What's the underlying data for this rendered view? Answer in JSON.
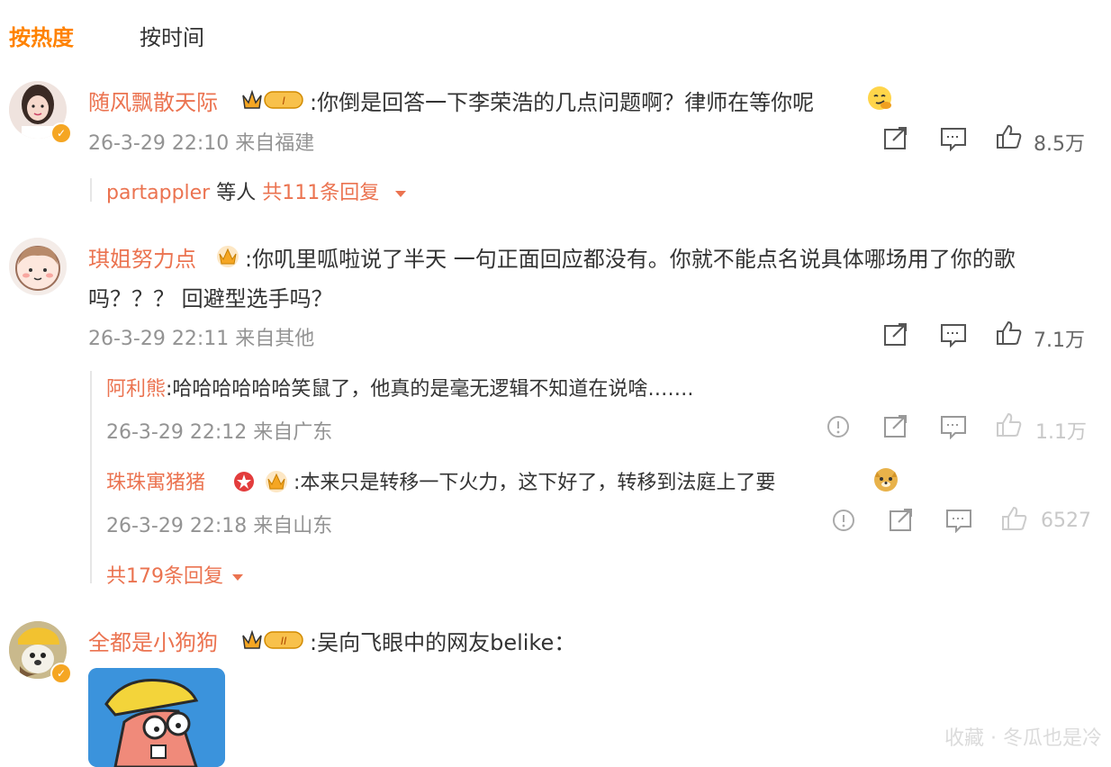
{
  "tabs": {
    "hot": "按热度",
    "time": "按时间"
  },
  "comments": [
    {
      "user": "随风飘散天际",
      "text": ":你倒是回答一下李荣浩的几点问题啊？律师在等你呢",
      "meta": "26-3-29 22:10 来自福建",
      "likes": "8.5万",
      "replies_summary": {
        "users": "partappler",
        "mid": " 等人 ",
        "count": "共111条回复"
      }
    },
    {
      "user": "琪姐努力点",
      "text_line1": ":你叽里呱啦说了半天 一句正面回应都没有。你就不能点名说具体哪场用了你的歌",
      "text_line2": "吗？？？ 回避型选手吗？",
      "meta": "26-3-29 22:11 来自其他",
      "likes": "7.1万",
      "replies": [
        {
          "user": "阿利熊",
          "text": ":哈哈哈哈哈哈笑鼠了，他真的是毫无逻辑不知道在说啥…….",
          "meta": "26-3-29 22:12 来自广东",
          "likes": "1.1万"
        },
        {
          "user": "珠珠寓猪猪",
          "text": ":本来只是转移一下火力，这下好了，转移到法庭上了要",
          "meta": "26-3-29 22:18 来自山东",
          "likes": "6527"
        }
      ],
      "replies_total": "共179条回复"
    },
    {
      "user": "全都是小狗狗",
      "text": ":吴向飞眼中的网友belike："
    }
  ],
  "icons": {
    "share": "share-icon",
    "comment": "comment-icon",
    "like": "like-icon",
    "report": "report-icon",
    "dropdown": "chevron-down-icon"
  },
  "colors": {
    "accent": "#ff8200",
    "username": "#eb7350",
    "meta": "#939393"
  },
  "watermark": "收藏 · 冬瓜也是冷"
}
